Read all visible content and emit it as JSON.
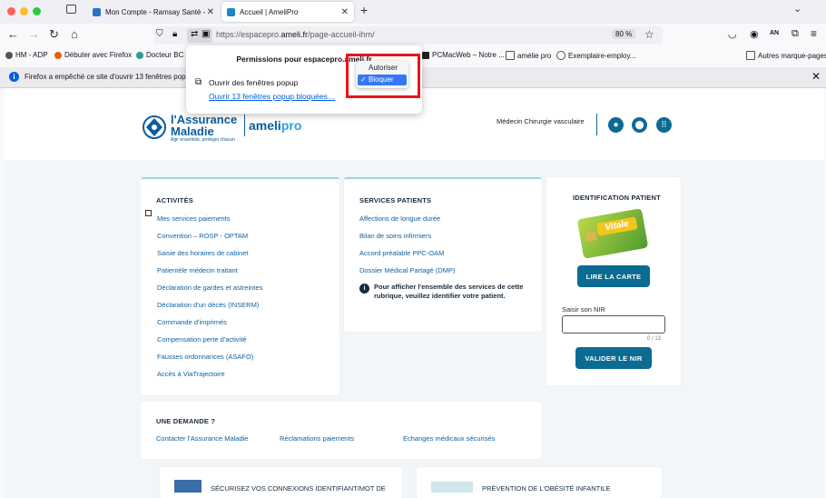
{
  "tabs": [
    {
      "label": "Mon Compte - Ramsay Santé -",
      "active": false
    },
    {
      "label": "Accueil | AmeliPro",
      "active": true
    }
  ],
  "new_tab_symbol": "+",
  "url": {
    "prefix": "https://espacepro.",
    "domain": "ameli.fr",
    "path": "/page-accueil-ihm/"
  },
  "zoom": "80 %",
  "bookmarks": {
    "left": [
      "HM - ADP",
      "Débuter avec Firefox",
      "Docteur BC",
      "PCMacWeb – Notre ...",
      "amélie pro",
      "Exemplaire-employ..."
    ],
    "right": "Autres marque-pages"
  },
  "notification": "Firefox a empêché ce site d'ouvrir 13 fenêtres popup",
  "permissions": {
    "title": "Permissions pour espacepro.ameli.fr",
    "row_label": "Ouvrir des fenêtres popup",
    "link": "Ouvrir 13 fenêtres popup bloquées…",
    "options": [
      "Autoriser",
      "Bloquer"
    ],
    "selected": "Bloquer"
  },
  "site": {
    "logo_line1": "l'Assurance",
    "logo_line2": "Maladie",
    "logo_tagline": "Agir ensemble, protéger chacun",
    "logo_product": "ameli",
    "logo_product_suffix": "pro",
    "user_role": "Médecin Chirurgie vasculaire"
  },
  "activites": {
    "title": "ACTIVITÉS",
    "items": [
      "Mes services paiements",
      "Convention – ROSP - OPTAM",
      "Saisie des horaires de cabinet",
      "Patientèle médecin traitant",
      "Déclaration de gardes et astreintes",
      "Déclaration d'un décès (INSERM)",
      "Commande d'imprimés",
      "Compensation perte d'activité",
      "Fausses ordonnances (ASAFO)",
      "Accès à ViaTrajectoire"
    ]
  },
  "services": {
    "title": "SERVICES PATIENTS",
    "items": [
      "Affections de longue durée",
      "Bilan de soins infirmiers",
      "Accord préalable PPC-OAM",
      "Dossier Médical Partagé (DMP)"
    ],
    "info": "Pour afficher l'ensemble des services de cette rubrique, veuillez identifier votre patient."
  },
  "identification": {
    "title": "IDENTIFICATION PATIENT",
    "card_text": "Vitale",
    "read_button": "LIRE LA CARTE",
    "nir_label": "Saisir son NIR",
    "nir_counter": "0 / 13",
    "validate_button": "VALIDER LE NIR"
  },
  "demande": {
    "title": "UNE DEMANDE ?",
    "links": [
      "Contacter l'Assurance Maladie",
      "Réclamations paiements",
      "Echanges médicaux sécurisés"
    ]
  },
  "promos": [
    "SÉCURISEZ VOS CONNEXIONS IDENTIFIANT/MOT DE",
    "PRÉVENTION DE L'OBÉSITÉ INFANTILE"
  ],
  "colors": {
    "accent": "#0b6b92",
    "link": "#0c62a4",
    "highlight": "#e8141b",
    "select": "#3478f6"
  }
}
